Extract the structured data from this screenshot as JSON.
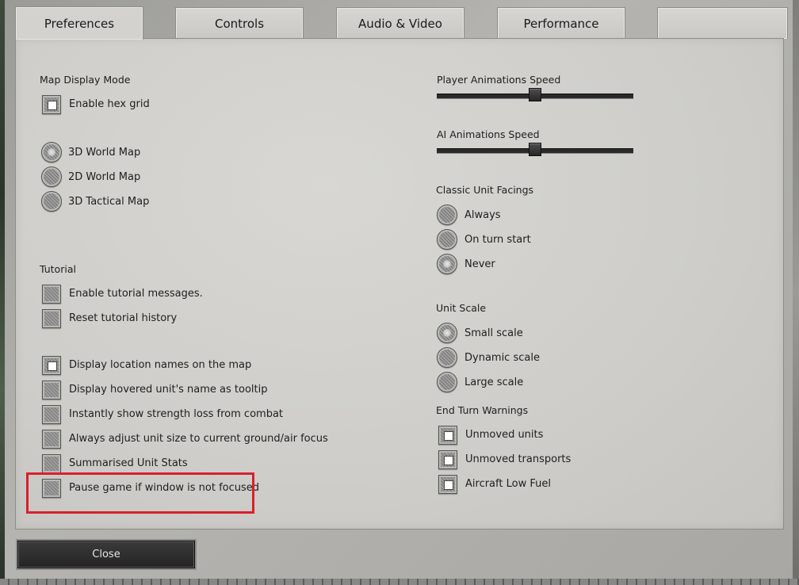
{
  "tabs": [
    "Preferences",
    "Controls",
    "Audio & Video",
    "Performance",
    ""
  ],
  "map_display": {
    "title": "Map Display Mode",
    "hex_grid_label": "Enable hex grid",
    "hex_grid_checked": true,
    "modes": [
      {
        "label": "3D World Map",
        "selected": true
      },
      {
        "label": "2D World Map",
        "selected": false
      },
      {
        "label": "3D Tactical Map",
        "selected": false
      }
    ]
  },
  "tutorial": {
    "title": "Tutorial",
    "items": [
      {
        "label": "Enable tutorial messages.",
        "checked": false
      },
      {
        "label": "Reset tutorial history",
        "checked": false
      }
    ]
  },
  "general": {
    "items": [
      {
        "label": "Display location names on the map",
        "checked": true
      },
      {
        "label": "Display hovered unit's name as tooltip",
        "checked": false
      },
      {
        "label": "Instantly show strength loss from combat",
        "checked": false
      },
      {
        "label": "Always adjust unit size to current ground/air focus",
        "checked": false
      },
      {
        "label": "Summarised Unit Stats",
        "checked": false
      },
      {
        "label": "Pause game if window is not focused",
        "checked": false
      }
    ]
  },
  "player_anim": {
    "title": "Player Animations Speed",
    "value": 0.5
  },
  "ai_anim": {
    "title": "AI Animations Speed",
    "value": 0.5
  },
  "facings": {
    "title": "Classic Unit Facings",
    "options": [
      {
        "label": "Always",
        "selected": false
      },
      {
        "label": "On turn start",
        "selected": false
      },
      {
        "label": "Never",
        "selected": true
      }
    ]
  },
  "unit_scale": {
    "title": "Unit Scale",
    "options": [
      {
        "label": "Small scale",
        "selected": true
      },
      {
        "label": "Dynamic scale",
        "selected": false
      },
      {
        "label": "Large scale",
        "selected": false
      }
    ]
  },
  "end_turn": {
    "title": "End Turn Warnings",
    "items": [
      {
        "label": "Unmoved units",
        "checked": true
      },
      {
        "label": "Unmoved transports",
        "checked": true
      },
      {
        "label": "Aircraft Low Fuel",
        "checked": true
      }
    ]
  },
  "close_label": "Close",
  "colors": {
    "highlight": "#d9202c",
    "panel": "#d0cfcb"
  }
}
